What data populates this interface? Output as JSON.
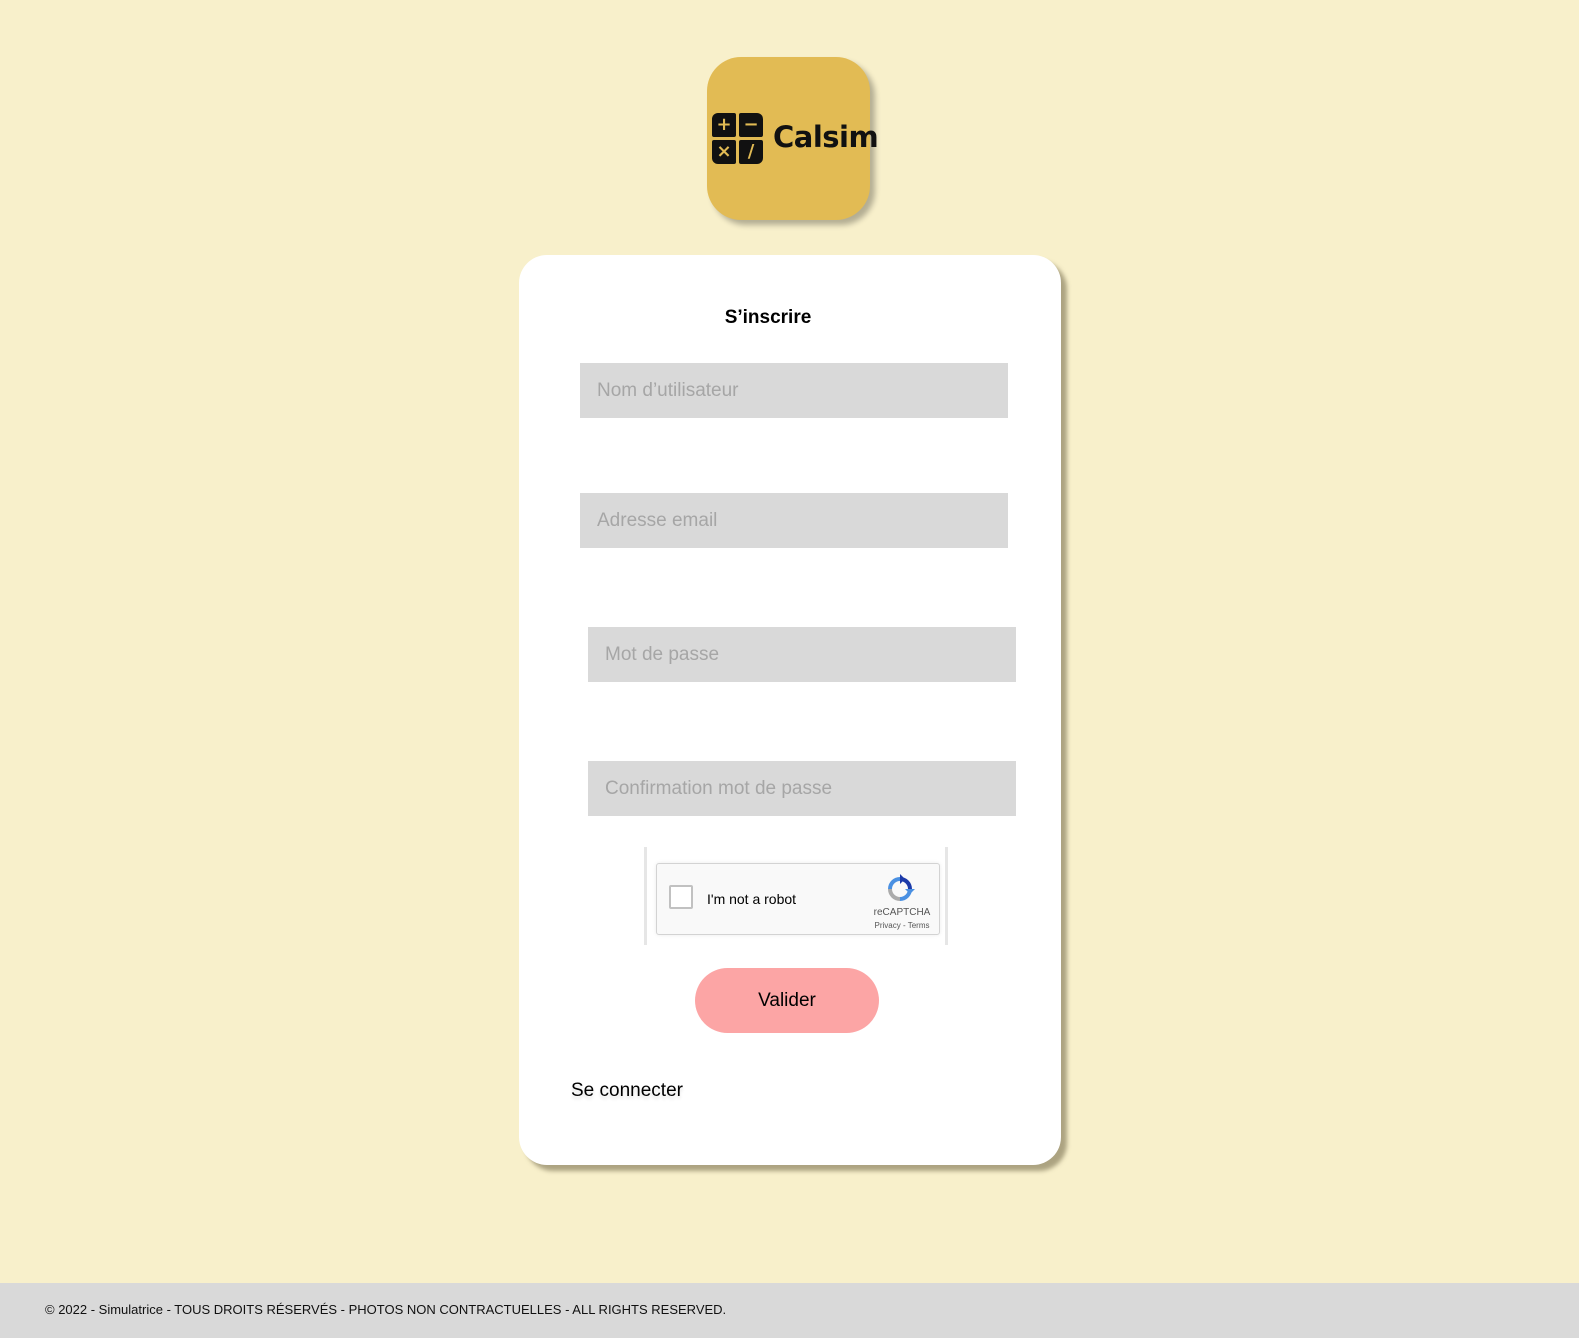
{
  "logo": {
    "brand_name": "Calsim",
    "icon_symbols": [
      "+",
      "−",
      "×",
      "/"
    ],
    "tile_color": "#e2bb54"
  },
  "form": {
    "title": "S’inscrire",
    "username_placeholder": "Nom d’utilisateur",
    "email_placeholder": "Adresse email",
    "password_placeholder": "Mot de passe",
    "confirm_password_placeholder": "Confirmation mot de passe",
    "submit_label": "Valider",
    "login_link_label": "Se connecter"
  },
  "recaptcha": {
    "label": "I'm not a robot",
    "brand": "reCAPTCHA",
    "privacy_label": "Privacy",
    "separator": " - ",
    "terms_label": "Terms",
    "checked": false
  },
  "footer": {
    "text": "© 2022 - Simulatrice - TOUS DROITS RÉSERVÉS - PHOTOS NON CONTRACTUELLES - ALL RIGHTS RESERVED."
  },
  "colors": {
    "background": "#f8f0cb",
    "accent": "#e2bb54",
    "button": "#fca5a5",
    "field": "#d9d9d9",
    "footer": "#d9d9d9"
  }
}
